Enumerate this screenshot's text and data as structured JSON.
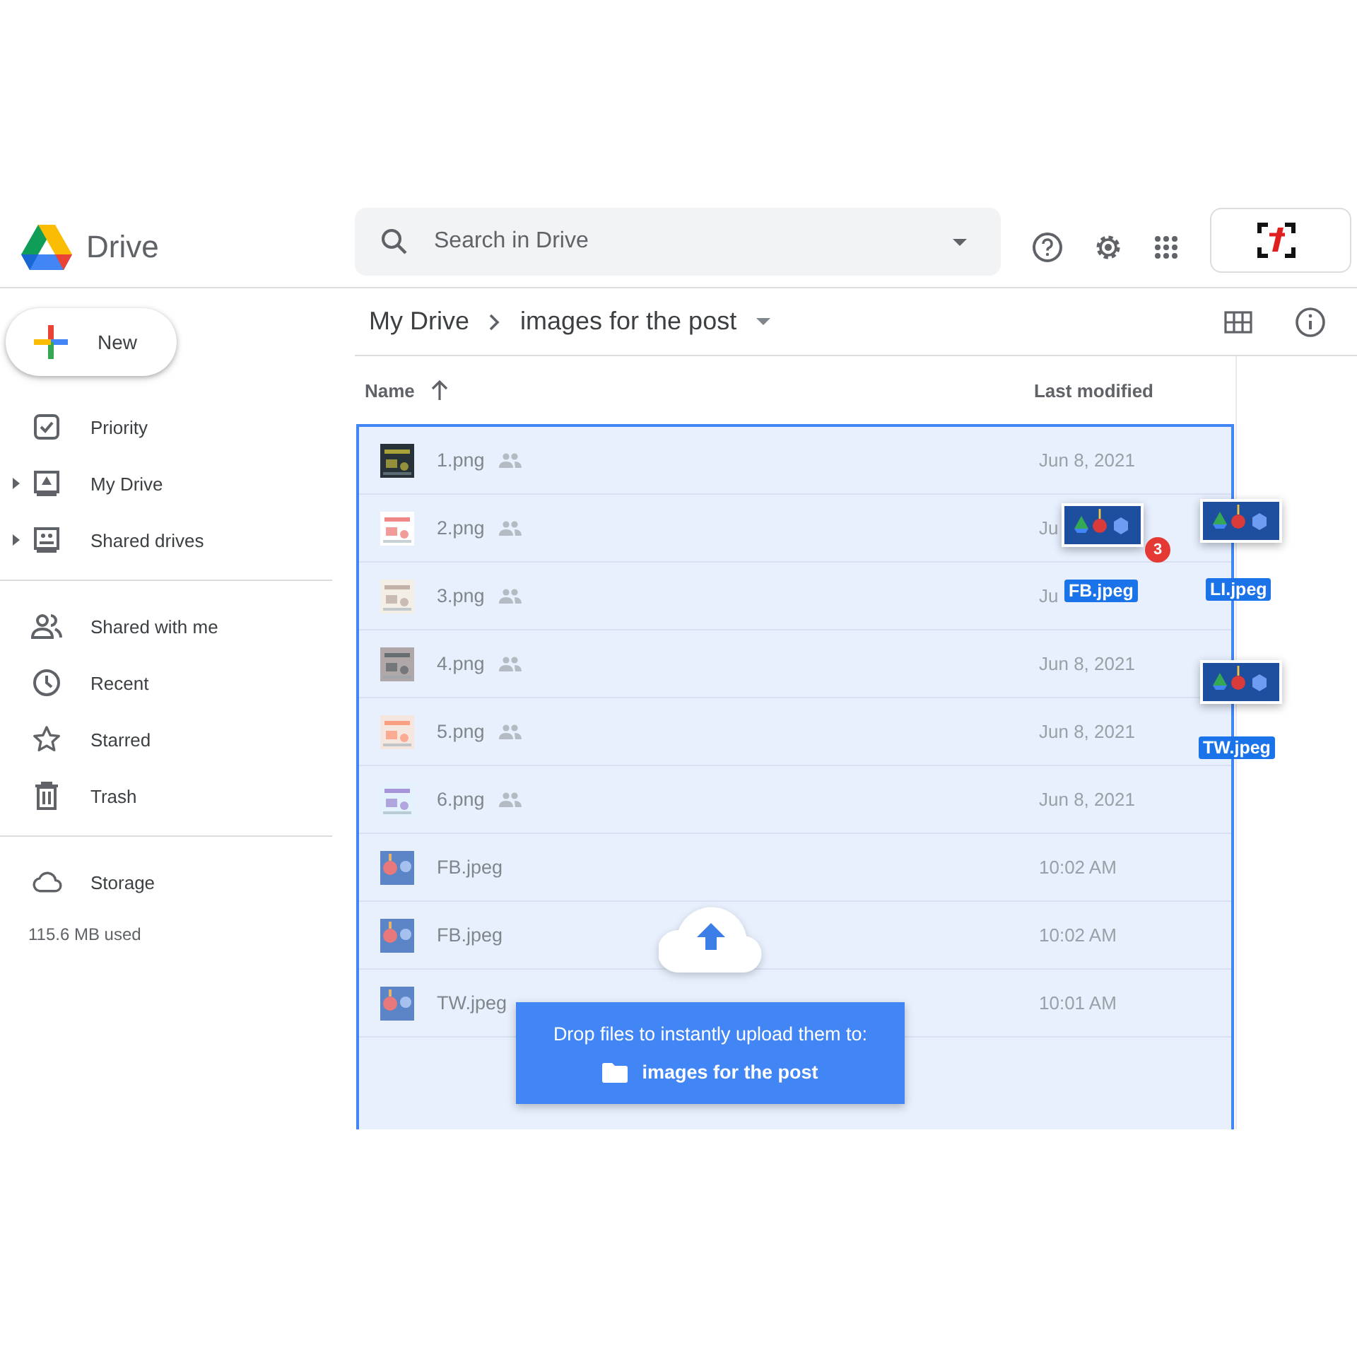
{
  "app": {
    "name": "Drive"
  },
  "search": {
    "placeholder": "Search in Drive"
  },
  "new_button": "New",
  "sidebar": {
    "groups": [
      [
        {
          "label": "Priority",
          "expandable": false
        },
        {
          "label": "My Drive",
          "expandable": true
        },
        {
          "label": "Shared drives",
          "expandable": true
        }
      ],
      [
        {
          "label": "Shared with me",
          "expandable": false
        },
        {
          "label": "Recent",
          "expandable": false
        },
        {
          "label": "Starred",
          "expandable": false
        },
        {
          "label": "Trash",
          "expandable": false
        }
      ],
      [
        {
          "label": "Storage",
          "expandable": false
        }
      ]
    ],
    "storage_used": "115.6 MB used"
  },
  "breadcrumb": [
    "My Drive",
    "images for the post"
  ],
  "table": {
    "columns": [
      "Name",
      "Last modified"
    ],
    "rows": [
      {
        "name": "1.png",
        "shared": true,
        "modified": "Jun 8, 2021"
      },
      {
        "name": "2.png",
        "shared": true,
        "modified": "Ju"
      },
      {
        "name": "3.png",
        "shared": true,
        "modified": "Ju"
      },
      {
        "name": "4.png",
        "shared": true,
        "modified": "Jun 8, 2021"
      },
      {
        "name": "5.png",
        "shared": true,
        "modified": "Jun 8, 2021"
      },
      {
        "name": "6.png",
        "shared": true,
        "modified": "Jun 8, 2021"
      },
      {
        "name": "FB.jpeg",
        "shared": false,
        "modified": "10:02 AM"
      },
      {
        "name": "FB.jpeg",
        "shared": false,
        "modified": "10:02 AM"
      },
      {
        "name": "TW.jpeg",
        "shared": false,
        "modified": "10:01 AM"
      }
    ]
  },
  "drag": {
    "count": "3",
    "items": [
      {
        "label": "FB.jpeg"
      },
      {
        "label": "LI.jpeg"
      },
      {
        "label": "TW.jpeg"
      }
    ]
  },
  "drop_banner": {
    "message": "Drop files to instantly upload them to:",
    "folder": "images for the post"
  }
}
